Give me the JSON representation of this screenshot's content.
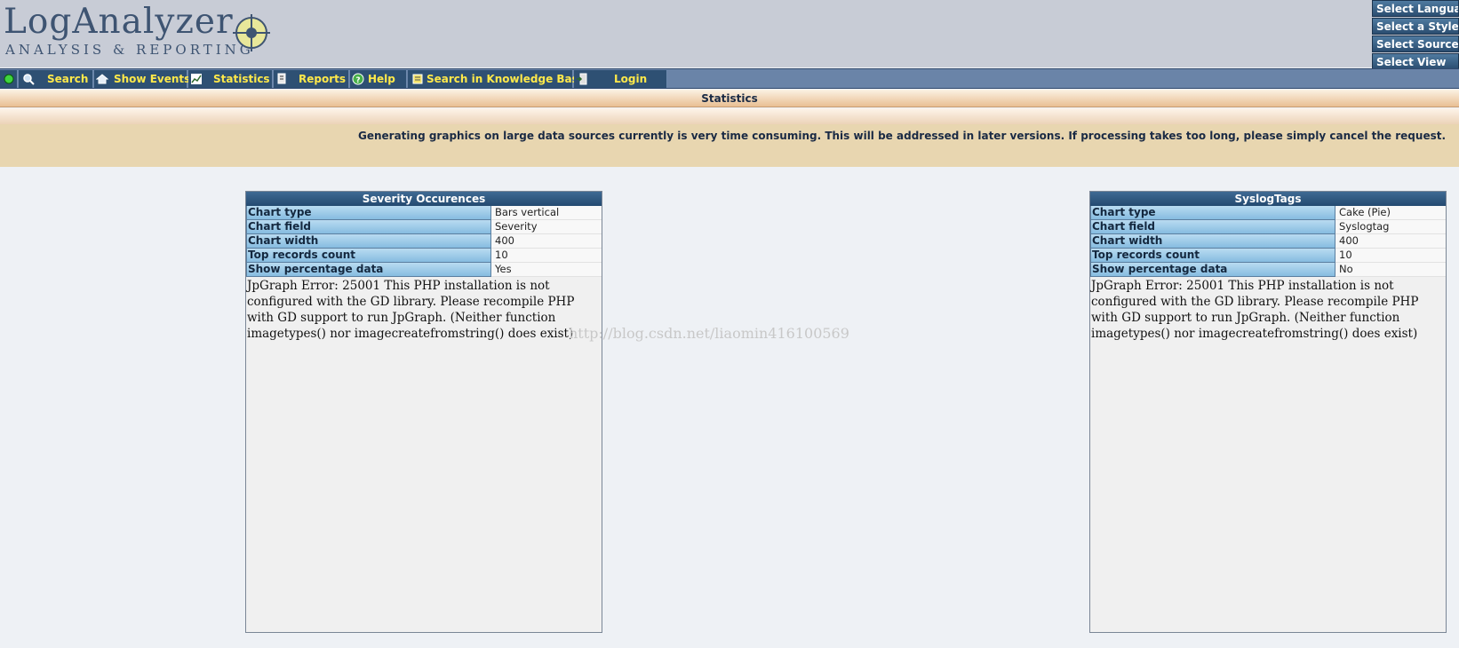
{
  "header": {
    "logo_title": "LogAnalyzer",
    "logo_subtitle": "ANALYSIS & REPORTING",
    "right_menu": [
      "Select Language",
      "Select a Style",
      "Select Source",
      "Select View"
    ]
  },
  "nav": {
    "items": [
      {
        "label": "Search",
        "icon": "search-icon"
      },
      {
        "label": "Show Events",
        "icon": "home-icon"
      },
      {
        "label": "Statistics",
        "icon": "chart-icon"
      },
      {
        "label": "Reports",
        "icon": "report-icon"
      },
      {
        "label": "Help",
        "icon": "help-icon"
      },
      {
        "label": "Search in Knowledge Base",
        "icon": "knowledge-base-icon"
      },
      {
        "label": "Login",
        "icon": "login-icon"
      }
    ]
  },
  "page": {
    "title": "Statistics",
    "info": "Generating graphics on large data sources currently is very time consuming. This will be addressed in later versions. If processing takes too long, please simply cancel the request."
  },
  "charts": [
    {
      "title": "Severity Occurences",
      "rows": [
        {
          "key": "Chart type",
          "value": "Bars vertical"
        },
        {
          "key": "Chart field",
          "value": "Severity"
        },
        {
          "key": "Chart width",
          "value": "400"
        },
        {
          "key": "Top records count",
          "value": "10"
        },
        {
          "key": "Show percentage data",
          "value": "Yes"
        }
      ],
      "error": "JpGraph Error: 25001 This PHP installation is not configured with the GD library. Please recompile PHP with GD support to run JpGraph. (Neither function imagetypes() nor imagecreatefromstring() does exist)"
    },
    {
      "title": "SyslogTags",
      "rows": [
        {
          "key": "Chart type",
          "value": "Cake (Pie)"
        },
        {
          "key": "Chart field",
          "value": "Syslogtag"
        },
        {
          "key": "Chart width",
          "value": "400"
        },
        {
          "key": "Top records count",
          "value": "10"
        },
        {
          "key": "Show percentage data",
          "value": "No"
        }
      ],
      "error": "JpGraph Error: 25001 This PHP installation is not configured with the GD library. Please recompile PHP with GD support to run JpGraph. (Neither function imagetypes() nor imagecreatefromstring() does exist)"
    }
  ],
  "watermark": "http://blog.csdn.net/liaomin416100569",
  "colors": {
    "header_bg": "#c8ccd6",
    "nav_bg": "#2e5073",
    "nav_text": "#ffe94a",
    "info_band": "#e8d6b0",
    "panel_header": "#244a70"
  }
}
